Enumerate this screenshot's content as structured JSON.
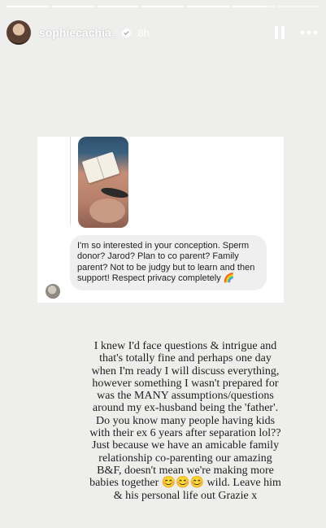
{
  "story": {
    "segments_total": 7,
    "current_segment": 6,
    "current_segment_progress": 0.8
  },
  "header": {
    "username": "sophiecachia_",
    "verified_icon": "verified-badge-icon",
    "time_ago": "8h",
    "pause_icon": "pause-icon",
    "more_icon": "more-options-icon"
  },
  "embedded_post": {
    "comment_text": "I'm so interested in your conception. Sperm donor? Jarod? Plan to co parent? Family parent? Not to be judgy but to learn and then support! Respect privacy completely 🌈"
  },
  "caption": {
    "text": "I knew I'd face questions & intrigue and that's totally fine and perhaps one day when I'm ready I will discuss everything, however something I wasn't prepared for was the MANY assumptions/questions around my ex-husband being the 'father'. Do you know many people having kids with their ex 6 years after separation lol?? Just because we have an amicable family relationship co-parenting our amazing B&F, doesn't mean we're making more babies together 😊😊😊 wild. Leave him & his personal life out Grazie x"
  },
  "colors": {
    "background": "#eeefed",
    "bubble": "#efefef"
  }
}
